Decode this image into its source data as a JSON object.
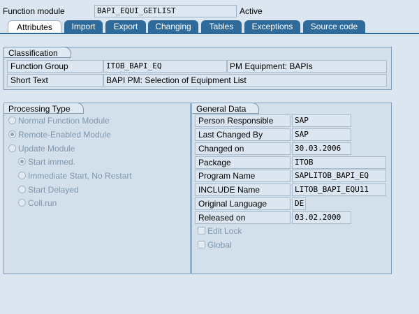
{
  "header": {
    "function_module_label": "Function module",
    "function_module_value": "BAPI_EQUI_GETLIST",
    "status": "Active"
  },
  "tabs": [
    {
      "label": "Attributes",
      "active": true
    },
    {
      "label": "Import",
      "active": false
    },
    {
      "label": "Export",
      "active": false
    },
    {
      "label": "Changing",
      "active": false
    },
    {
      "label": "Tables",
      "active": false
    },
    {
      "label": "Exceptions",
      "active": false
    },
    {
      "label": "Source code",
      "active": false
    }
  ],
  "classification": {
    "title": "Classification",
    "function_group_label": "Function Group",
    "function_group_value": "ITOB_BAPI_EQ",
    "function_group_desc": "PM Equipment: BAPIs",
    "short_text_label": "Short Text",
    "short_text_value": "BAPI PM: Selection of Equipment List"
  },
  "processing_type": {
    "title": "Processing Type",
    "options": [
      {
        "label": "Normal Function Module",
        "selected": false
      },
      {
        "label": "Remote-Enabled Module",
        "selected": true
      },
      {
        "label": "Update Module",
        "selected": false
      },
      {
        "label": "Start immed.",
        "selected": true
      },
      {
        "label": "Immediate Start, No Restart",
        "selected": false
      },
      {
        "label": "Start Delayed",
        "selected": false
      },
      {
        "label": "Coll.run",
        "selected": false
      }
    ]
  },
  "general_data": {
    "title": "General Data",
    "rows": [
      {
        "label": "Person Responsible",
        "value": "SAP"
      },
      {
        "label": "Last Changed By",
        "value": "SAP"
      },
      {
        "label": "Changed on",
        "value": "30.03.2006"
      },
      {
        "label": "Package",
        "value": "ITOB"
      },
      {
        "label": "Program Name",
        "value": "SAPLITOB_BAPI_EQ"
      },
      {
        "label": "INCLUDE Name",
        "value": "LITOB_BAPI_EQU11"
      },
      {
        "label": "Original Language",
        "value": "DE"
      },
      {
        "label": "Released on",
        "value": "03.02.2000"
      }
    ],
    "edit_lock_label": "Edit Lock",
    "edit_lock_checked": false,
    "global_label": "Global",
    "global_checked": false
  },
  "colors": {
    "background": "#dbe6f0",
    "tab_inactive": "#2f6b9a",
    "tab_active": "#ffffff",
    "disabled_text": "#7f97ad"
  }
}
